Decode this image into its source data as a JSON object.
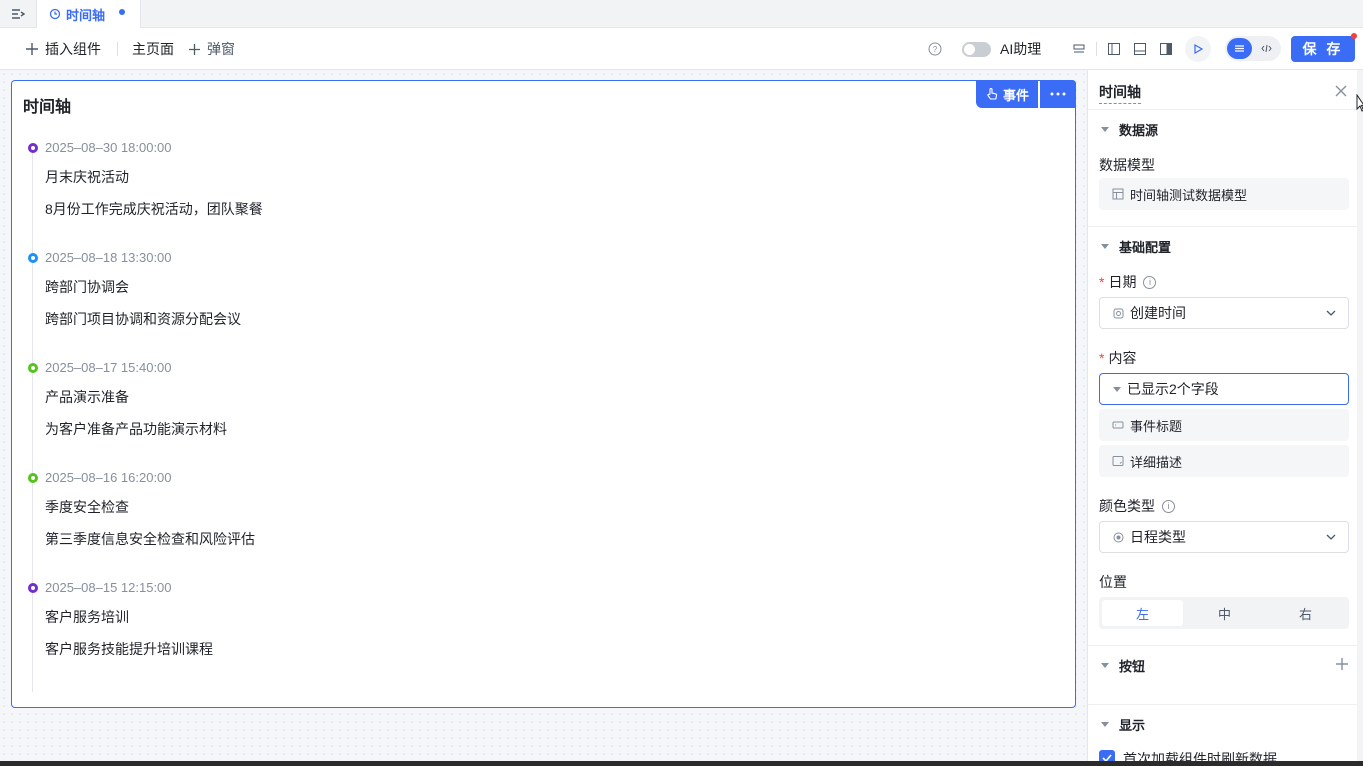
{
  "tab": {
    "label": "时间轴"
  },
  "toolbar": {
    "insert_label": "插入组件",
    "main_page_label": "主页面",
    "popup_label": "弹窗",
    "ai_label": "AI助理",
    "save_label": "保 存"
  },
  "canvas": {
    "card_title": "时间轴",
    "event_btn_label": "事件",
    "timeline": [
      {
        "time": "2025–08–30 18:00:00",
        "title": "月末庆祝活动",
        "desc": "8月份工作完成庆祝活动，团队聚餐",
        "color": "#722ed1"
      },
      {
        "time": "2025–08–18 13:30:00",
        "title": "跨部门协调会",
        "desc": "跨部门项目协调和资源分配会议",
        "color": "#1890ff"
      },
      {
        "time": "2025–08–17 15:40:00",
        "title": "产品演示准备",
        "desc": "为客户准备产品功能演示材料",
        "color": "#52c41a"
      },
      {
        "time": "2025–08–16 16:20:00",
        "title": "季度安全检查",
        "desc": "第三季度信息安全检查和风险评估",
        "color": "#52c41a"
      },
      {
        "time": "2025–08–15 12:15:00",
        "title": "客户服务培训",
        "desc": "客户服务技能提升培训课程",
        "color": "#722ed1"
      }
    ]
  },
  "panel": {
    "title": "时间轴",
    "datasource": {
      "section": "数据源",
      "model_label": "数据模型",
      "model_value": "时间轴测试数据模型"
    },
    "basic": {
      "section": "基础配置",
      "date_label": "日期",
      "date_value": "创建时间",
      "content_label": "内容",
      "content_value": "已显示2个字段",
      "content_fields": [
        "事件标题",
        "详细描述"
      ],
      "color_label": "颜色类型",
      "color_value": "日程类型",
      "position_label": "位置",
      "position_options": [
        "左",
        "中",
        "右"
      ],
      "position_selected": "左"
    },
    "buttons_section": "按钮",
    "display_section": "显示",
    "refresh_label": "首次加载组件时刷新数据"
  }
}
